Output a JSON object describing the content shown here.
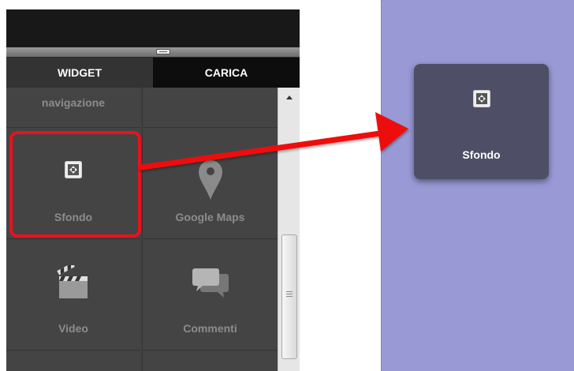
{
  "tabs": {
    "widget": "WIDGET",
    "carica": "CARICA"
  },
  "widgets": {
    "partial_left": "navigazione",
    "partial_right": "",
    "sfondo": "Sfondo",
    "google_maps": "Google Maps",
    "video": "Video",
    "commenti": "Commenti"
  },
  "drag_preview": {
    "label": "Sfondo"
  },
  "icons": {
    "sfondo": "background-expand-icon",
    "google_maps": "map-pin-icon",
    "video": "clapperboard-icon",
    "commenti": "speech-bubbles-icon"
  },
  "colors": {
    "highlight": "#e8121d",
    "canvas": "#9999d6",
    "drag_card": "#4e4e66",
    "panel": "#3d3d3d"
  }
}
